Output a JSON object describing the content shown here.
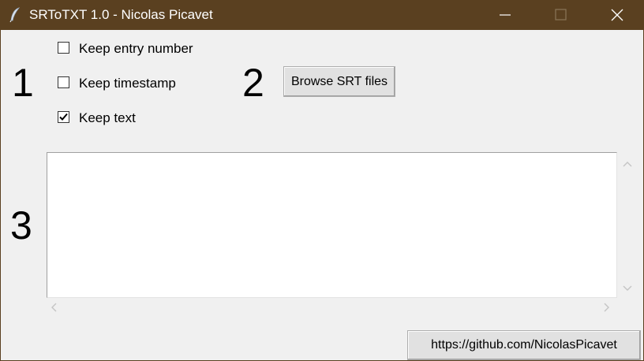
{
  "window": {
    "title": "SRToTXT 1.0 - Nicolas Picavet",
    "titlebar_color": "#5a4020",
    "icon": "feather-icon"
  },
  "steps": {
    "one": "1",
    "two": "2",
    "three": "3"
  },
  "options": [
    {
      "label": "Keep entry number",
      "checked": false
    },
    {
      "label": "Keep timestamp",
      "checked": false
    },
    {
      "label": "Keep text",
      "checked": true
    }
  ],
  "browse_button": {
    "label": "Browse SRT files"
  },
  "output": {
    "value": ""
  },
  "link_button": {
    "label": "https://github.com/NicolasPicavet"
  }
}
